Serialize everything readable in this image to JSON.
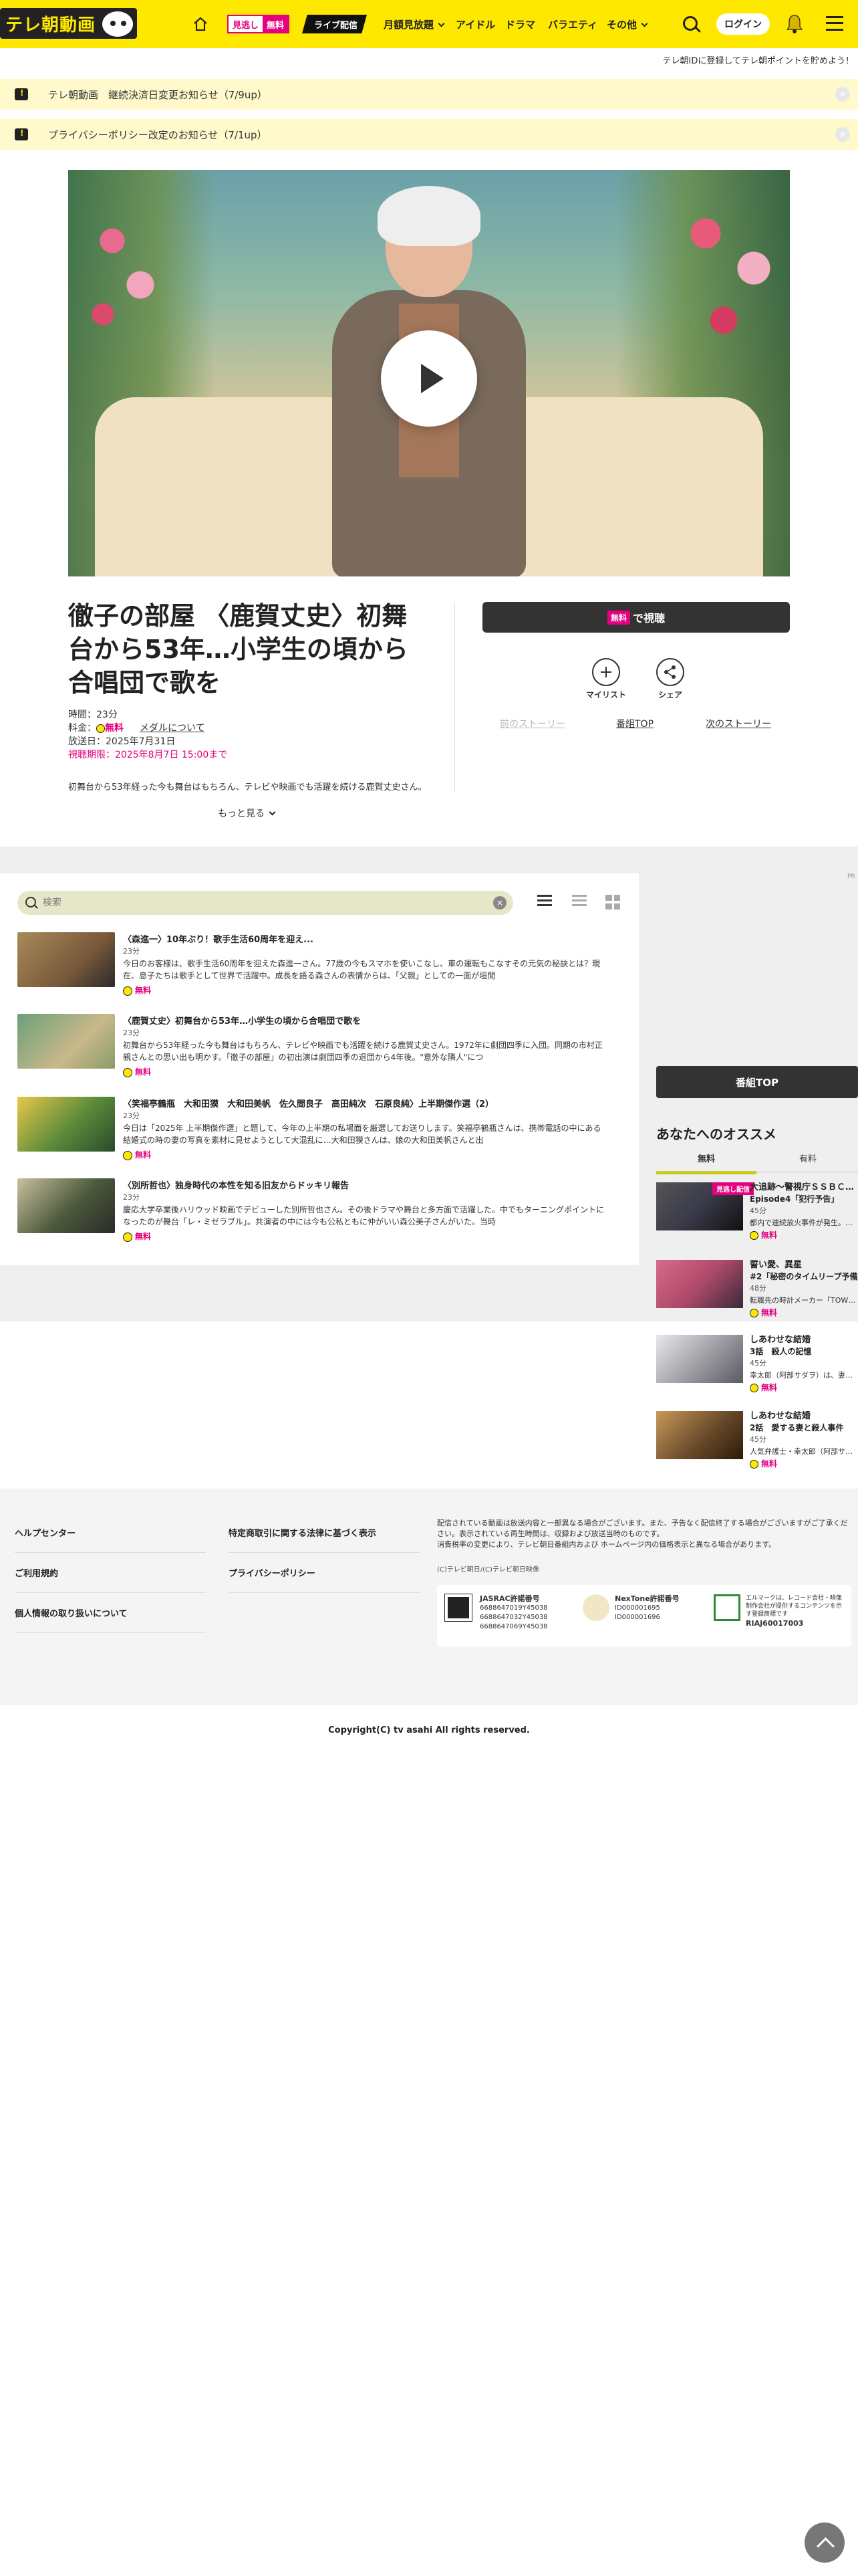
{
  "header": {
    "logo_text": "テレ朝動画",
    "free_badge": {
      "left": "見逃し",
      "right": "無料"
    },
    "live_badge": "ライブ配信",
    "nav": [
      "月額見放題",
      "アイドル",
      "ドラマ",
      "バラエティ",
      "その他"
    ],
    "login": "ログイン"
  },
  "sub_note": "テレ朝IDに登録してテレ朝ポイントを貯めよう！",
  "notices": [
    "テレ朝動画　継続決済日変更お知らせ（7/9up）",
    "プライバシーポリシー改定のお知らせ（7/1up）"
  ],
  "program": {
    "title": "徹子の部屋 〈鹿賀丈史〉初舞台から53年…小学生の頃から合唱団で歌を",
    "duration": "時間：23分",
    "fee_label": "料金：",
    "fee_free": "無料",
    "medal_link": "メダルについて",
    "air_date": "放送日：2025年7月31日",
    "limit": "視聴期限：2025年8月7日 15:00まで",
    "desc": "初舞台から53年経った今も舞台はもちろん、テレビや映画でも活躍を続ける鹿賀丈史さん。",
    "more": "もっと見る"
  },
  "actions": {
    "watch_tag": "無料",
    "watch_label": "で視聴",
    "mylist": "マイリスト",
    "share": "シェア",
    "prev": "前のストーリー",
    "top": "番組TOP",
    "next": "次のストーリー"
  },
  "search": {
    "placeholder": "検索"
  },
  "ad_tag": "PR",
  "episodes": [
    {
      "title": "〈森進一〉10年ぶり！歌手生活60周年を迎え...",
      "duration": "23分",
      "summary": "今日のお客様は、歌手生活60周年を迎えた森進一さん。77歳の今もスマホを使いこなし、車の運転もこなすその元気の秘訣とは？現在、息子たちは歌手として世界で活躍中。成長を語る森さんの表情からは、「父親」としての一面が垣間",
      "free": "無料",
      "thumb_color": "#7a5a3a"
    },
    {
      "title": "〈鹿賀丈史〉初舞台から53年…小学生の頃から合唱団で歌を",
      "duration": "23分",
      "summary": "初舞台から53年経った今も舞台はもちろん、テレビや映画でも活躍を続ける鹿賀丈史さん。1972年に劇団四季に入団。同期の市村正親さんとの思い出も明かす。「徹子の部屋」の初出演は劇団四季の退団から4年後。\"意外な隣人\"につ",
      "free": "無料",
      "thumb_color": "#8a9a6a"
    },
    {
      "title": "〈笑福亭鶴瓶　大和田獏　大和田美帆　佐久間良子　高田純次　石原良純〉上半期傑作選（2）",
      "duration": "23分",
      "summary": "今日は「2025年 上半期傑作選」と題して、今年の上半期の私場面を厳選してお送りします。笑福亭鶴瓶さんは、携帯電話の中にある結婚式の時の妻の写真を素材に見せようとして大混乱に…大和田獏さんは、娘の大和田美帆さんと出",
      "free": "無料",
      "thumb_color": "#5a8a3a"
    },
    {
      "title": "〈別所哲也〉独身時代の本性を知る旧友からドッキリ報告",
      "duration": "23分",
      "summary": "慶応大学卒業後ハリウッド映画でデビューした別所哲也さん。その後ドラマや舞台と多方面で活躍した。中でもターニングポイントになったのが舞台「レ・ミゼラブル」。共演者の中には今も公私ともに仲がいい森公美子さんがいた。当時",
      "free": "無料",
      "thumb_color": "#4a5a3a"
    }
  ],
  "sidebar": {
    "top_button": "番組TOP",
    "reco_title": "あなたへのオススメ",
    "tabs": [
      "無料",
      "有料"
    ],
    "items": [
      {
        "title": "大追跡～警視庁ＳＳＢＣ…",
        "sub": "Episode4「犯行予告」",
        "duration": "45分",
        "summary": "都内で連続放火事件が発生。…",
        "free": "無料",
        "badge": "見逃し配信",
        "thumb_color": "#3a3a4a"
      },
      {
        "title": "誓い愛、異星",
        "sub": "#2「秘密のタイムリープ予備」",
        "duration": "48分",
        "summary": "転職先の時計メーカー「TOW…",
        "free": "無料",
        "badge": "",
        "thumb_color": "#b04a6a"
      },
      {
        "title": "しあわせな結婚",
        "sub": "3話　殺人の記憶",
        "duration": "45分",
        "summary": "幸太郎（阿部サダヲ）は、妻…",
        "free": "無料",
        "badge": "",
        "thumb_color": "#9a9aa0"
      },
      {
        "title": "しあわせな結婚",
        "sub": "2話　愛する妻と殺人事件",
        "duration": "45分",
        "summary": "人気弁護士・幸太郎（阿部サ…",
        "free": "無料",
        "badge": "",
        "thumb_color": "#6a4a2a"
      }
    ]
  },
  "footer": {
    "links_left": [
      "ヘルプセンター",
      "ご利用規約",
      "個人情報の取り扱いについて"
    ],
    "links_right": [
      "特定商取引に関する法律に基づく表示",
      "プライバシーポリシー"
    ],
    "note": "配信されている動画は放送内容と一部異なる場合がございます。また、予告なく配信終了する場合がございますがご了承ください。表示されている再生時間は、収録および放送当時のものです。\n消費税率の変更により、テレビ朝日番組内および ホームページ内の価格表示と異なる場合があります。",
    "small": "(C)テレビ朝日/(C)テレビ朝日映像",
    "rights": {
      "jasrac_title": "JASRAC許諾番号",
      "jasrac_nums": "6688647019Y45038\n6688647032Y45038\n6688647069Y45038",
      "nextone_title": "NexTone許諾番号",
      "nextone_nums": "ID000001695\nID000001696",
      "riaj_text": "エルマークは、レコード会社・映像制作会社が提供するコンテンツを示す登録商標です",
      "riaj_num": "RIAJ60017003"
    },
    "copyright": "Copyright(C) tv asahi All rights reserved."
  },
  "colors": {
    "brand_yellow": "#ffe800",
    "accent_pink": "#e4007f",
    "notice_bg": "#fff9cc"
  }
}
